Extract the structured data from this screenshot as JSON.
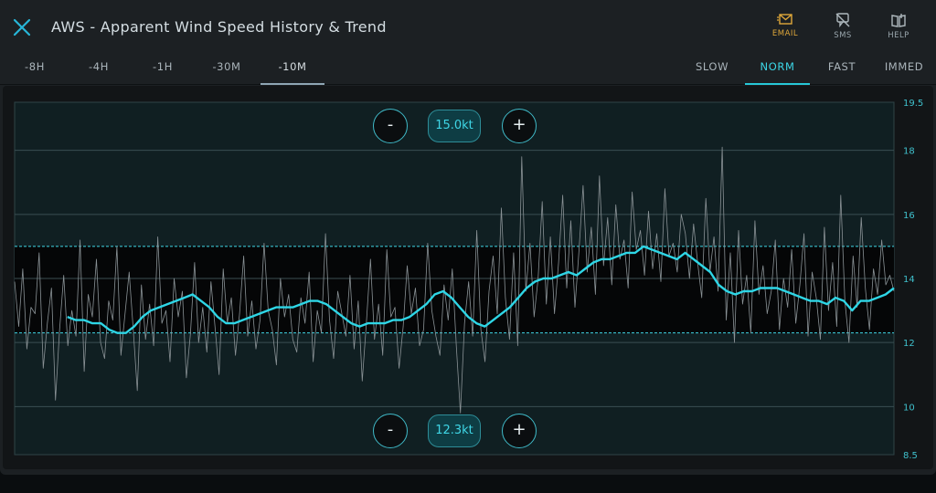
{
  "header": {
    "title": "AWS - Apparent Wind Speed History & Trend",
    "actions": [
      {
        "label": "EMAIL",
        "icon": "email-icon"
      },
      {
        "label": "SMS",
        "icon": "sms-off-icon"
      },
      {
        "label": "HELP",
        "icon": "help-book-icon"
      }
    ]
  },
  "tabs": {
    "time_ranges": [
      "-8H",
      "-4H",
      "-1H",
      "-30M",
      "-10M"
    ],
    "active_time_range": "-10M",
    "speeds": [
      "SLOW",
      "NORM",
      "FAST",
      "IMMED"
    ],
    "active_speed": "NORM"
  },
  "alarms": {
    "upper": {
      "value": 15.0,
      "label": "15.0kt",
      "minus": "-",
      "plus": "+"
    },
    "lower": {
      "value": 12.3,
      "label": "12.3kt",
      "minus": "-",
      "plus": "+"
    }
  },
  "colors": {
    "accent": "#27c8d8",
    "trend_line": "#2ed6e6",
    "raw_line": "#8a9296",
    "email": "#e0a83a",
    "grid": "#3a4f52"
  },
  "chart_data": {
    "type": "line",
    "ylim": [
      8.5,
      19.5
    ],
    "y_ticks": [
      8.5,
      10,
      12,
      14,
      16,
      18,
      19.5
    ],
    "y_tick_labels": [
      "8.5",
      "10",
      "12",
      "14",
      "16",
      "18",
      "19.5"
    ],
    "grid": true,
    "reference_lines": [
      15.0,
      12.3
    ],
    "series": [
      {
        "role": "trend",
        "x_start": 0.06,
        "x_end": 1.0,
        "values": [
          12.8,
          12.7,
          12.7,
          12.6,
          12.6,
          12.4,
          12.3,
          12.3,
          12.5,
          12.8,
          13.0,
          13.1,
          13.2,
          13.3,
          13.4,
          13.5,
          13.3,
          13.1,
          12.8,
          12.6,
          12.6,
          12.7,
          12.8,
          12.9,
          13.0,
          13.1,
          13.1,
          13.1,
          13.2,
          13.3,
          13.3,
          13.2,
          13.0,
          12.8,
          12.6,
          12.5,
          12.6,
          12.6,
          12.6,
          12.7,
          12.7,
          12.8,
          13.0,
          13.2,
          13.5,
          13.6,
          13.4,
          13.1,
          12.8,
          12.6,
          12.5,
          12.7,
          12.9,
          13.1,
          13.4,
          13.7,
          13.9,
          14.0,
          14.0,
          14.1,
          14.2,
          14.1,
          14.3,
          14.5,
          14.6,
          14.6,
          14.7,
          14.8,
          14.8,
          15.0,
          14.9,
          14.8,
          14.7,
          14.6,
          14.8,
          14.6,
          14.4,
          14.2,
          13.8,
          13.6,
          13.5,
          13.6,
          13.6,
          13.7,
          13.7,
          13.7,
          13.6,
          13.5,
          13.4,
          13.3,
          13.3,
          13.2,
          13.4,
          13.3,
          13.0,
          13.3,
          13.3,
          13.4,
          13.5,
          13.7
        ]
      },
      {
        "role": "raw",
        "x_start": 0.0,
        "x_end": 1.0,
        "values": [
          13.9,
          12.5,
          14.3,
          11.8,
          13.1,
          12.9,
          14.8,
          11.2,
          12.6,
          13.7,
          10.2,
          12.4,
          14.1,
          11.9,
          13.0,
          12.2,
          15.2,
          11.1,
          13.5,
          12.8,
          14.6,
          12.0,
          11.5,
          13.3,
          12.7,
          15.0,
          11.6,
          12.9,
          14.2,
          12.4,
          10.5,
          13.8,
          12.1,
          13.2,
          11.9,
          15.3,
          12.6,
          13.0,
          11.4,
          14.0,
          12.8,
          13.6,
          10.9,
          12.3,
          14.5,
          12.0,
          13.1,
          11.7,
          13.9,
          12.5,
          11.0,
          14.3,
          12.6,
          13.4,
          11.6,
          12.9,
          14.7,
          12.2,
          13.3,
          11.8,
          12.7,
          15.1,
          13.0,
          12.4,
          11.3,
          14.0,
          12.8,
          13.5,
          12.1,
          11.7,
          13.4,
          12.6,
          14.2,
          11.4,
          13.0,
          12.3,
          15.4,
          12.7,
          11.5,
          13.6,
          12.9,
          12.2,
          14.1,
          11.8,
          13.3,
          10.8,
          12.6,
          14.6,
          12.1,
          13.2,
          11.6,
          14.9,
          12.8,
          13.1,
          11.2,
          12.5,
          14.4,
          12.9,
          13.7,
          11.9,
          12.4,
          15.1,
          13.0,
          12.2,
          11.6,
          13.8,
          12.7,
          14.3,
          11.9,
          9.8,
          12.6,
          13.9,
          12.2,
          15.5,
          12.4,
          11.4,
          13.6,
          14.7,
          12.9,
          16.2,
          13.4,
          12.1,
          14.8,
          11.9,
          17.8,
          13.6,
          15.1,
          12.8,
          14.0,
          16.4,
          13.2,
          15.3,
          12.9,
          14.5,
          16.6,
          13.7,
          15.8,
          13.1,
          14.9,
          16.9,
          14.2,
          15.6,
          13.5,
          17.2,
          14.4,
          15.9,
          13.8,
          16.3,
          14.6,
          15.2,
          13.7,
          16.7,
          14.9,
          15.5,
          14.1,
          16.1,
          14.3,
          15.4,
          13.9,
          16.8,
          14.7,
          15.1,
          14.2,
          16.0,
          15.4,
          14.0,
          15.7,
          14.5,
          13.4,
          16.5,
          14.2,
          15.3,
          13.6,
          18.1,
          12.7,
          14.8,
          12.0,
          15.5,
          13.2,
          14.1,
          12.3,
          15.8,
          13.5,
          14.4,
          12.9,
          13.6,
          15.2,
          12.4,
          14.0,
          13.1,
          14.9,
          12.6,
          13.8,
          15.4,
          12.2,
          14.2,
          13.4,
          12.1,
          15.6,
          13.0,
          14.5,
          12.5,
          16.6,
          13.3,
          12.0,
          14.7,
          13.1,
          15.9,
          13.7,
          12.4,
          14.3,
          13.5,
          15.2,
          13.8,
          14.1,
          13.6
        ]
      }
    ]
  }
}
